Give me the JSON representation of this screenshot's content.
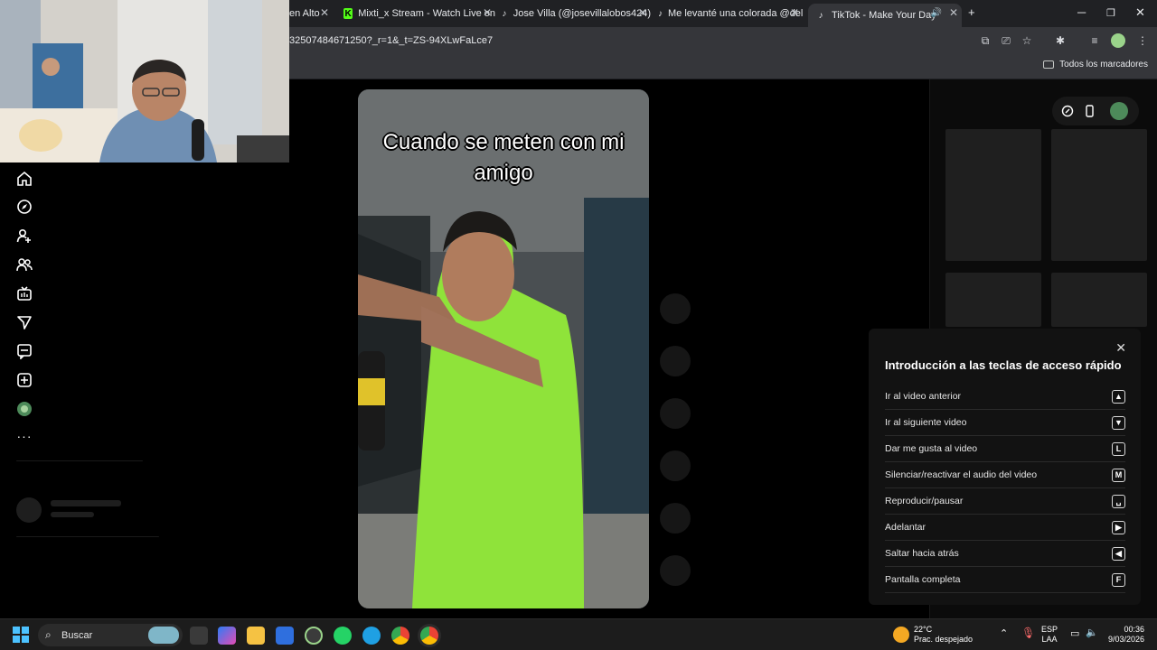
{
  "browser": {
    "tabs": [
      {
        "title": "en Alto",
        "icon": "generic"
      },
      {
        "title": "Mixti_x Stream - Watch Live on",
        "icon": "kick-icon"
      },
      {
        "title": "Jose Villa (@josevillalobos424)",
        "icon": "tiktok-icon"
      },
      {
        "title": "Me levanté una colorada @del",
        "icon": "tiktok-icon"
      },
      {
        "title": "TikTok - Make Your Day",
        "icon": "tiktok-icon"
      }
    ],
    "url": "32507484671250?_r=1&_t=ZS-94XLwFaLce7",
    "bookmarks_all": "Todos los marcadores"
  },
  "video": {
    "caption_line1": "Cuando se meten con mi",
    "caption_line2": "amigo"
  },
  "shortcuts": {
    "title": "Introducción a las teclas de acceso rápido",
    "items": [
      {
        "label": "Ir al video anterior",
        "key": "▲"
      },
      {
        "label": "Ir al siguiente video",
        "key": "▼"
      },
      {
        "label": "Dar me gusta al video",
        "key": "L"
      },
      {
        "label": "Silenciar/reactivar el audio del video",
        "key": "M"
      },
      {
        "label": "Reproducir/pausar",
        "key": "␣"
      },
      {
        "label": "Adelantar",
        "key": "▶"
      },
      {
        "label": "Saltar hacia atrás",
        "key": "◀"
      },
      {
        "label": "Pantalla completa",
        "key": "F"
      }
    ]
  },
  "taskbar": {
    "search_placeholder": "Buscar",
    "weather_temp": "22°C",
    "weather_desc": "Prac. despejado",
    "lang_1": "ESP",
    "lang_2": "LAA",
    "time": "00:36",
    "date": "9/03/2026"
  },
  "colors": {
    "accent_green": "#8fe33a",
    "tiktok_bg": "#000000"
  }
}
